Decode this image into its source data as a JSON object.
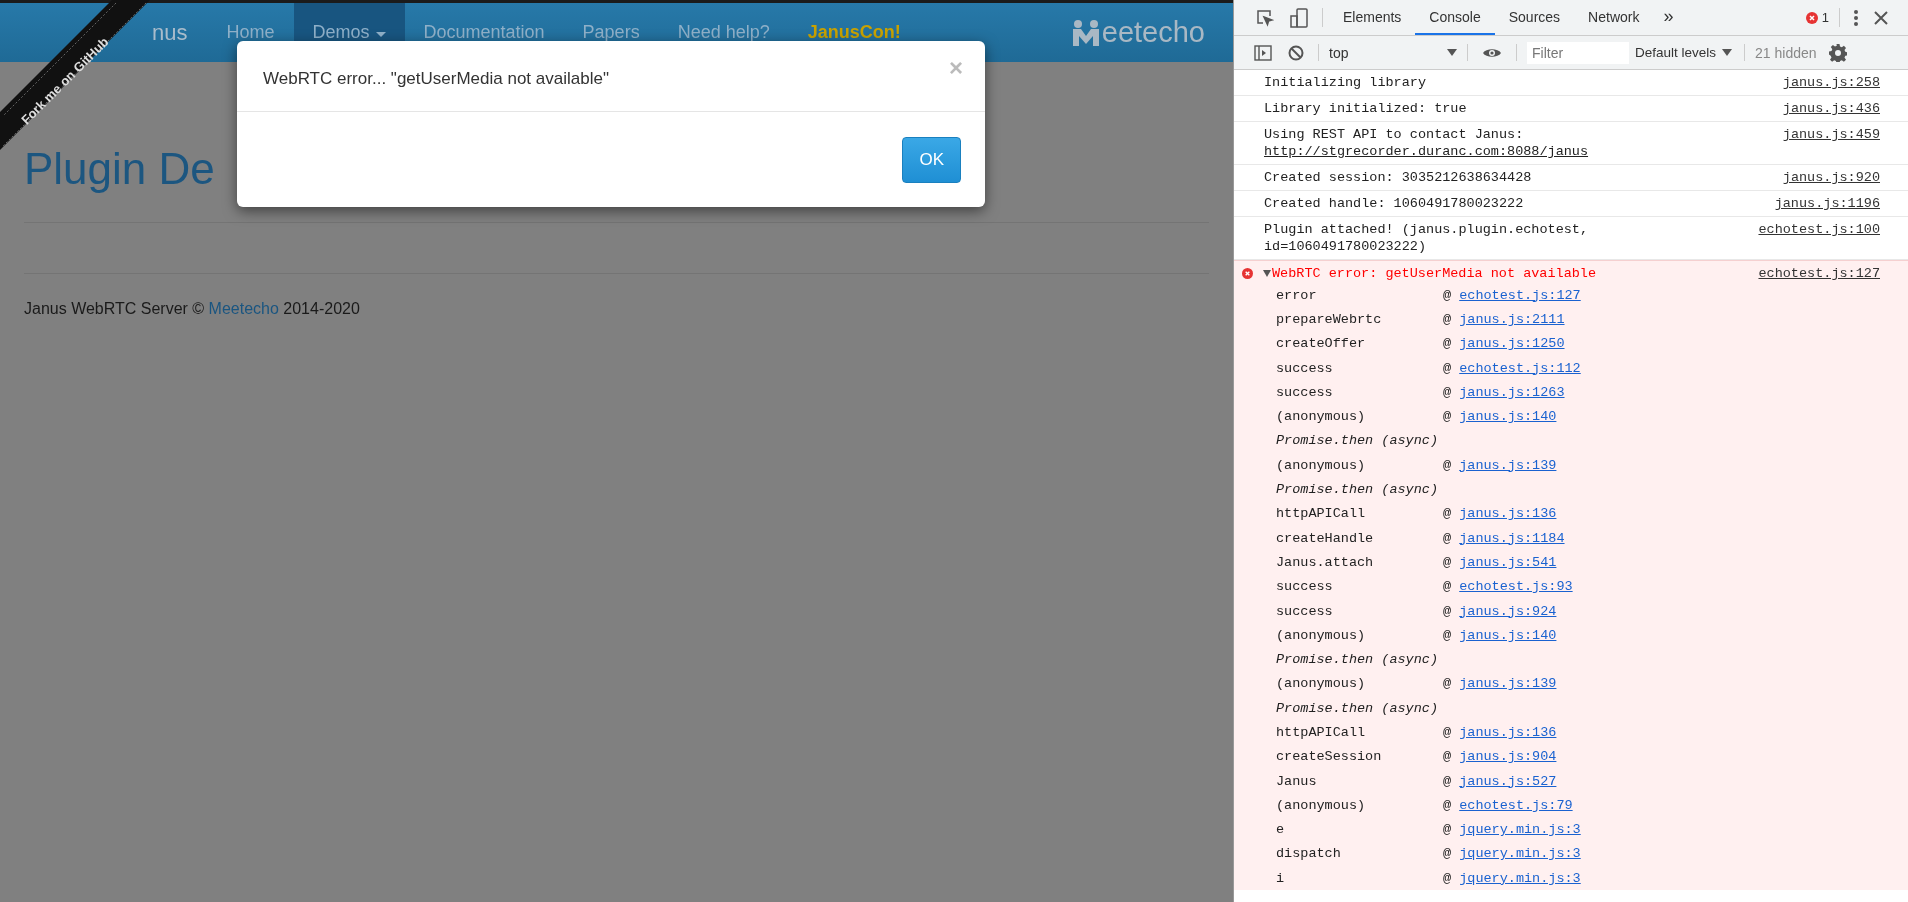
{
  "ribbon": {
    "text": "Fork me on GitHub"
  },
  "navbar": {
    "brand": "nus",
    "items": [
      {
        "label": "Home",
        "selected": false,
        "kind": "link"
      },
      {
        "label": "Demos",
        "selected": true,
        "kind": "dropdown"
      },
      {
        "label": "Documentation",
        "selected": false,
        "kind": "link"
      },
      {
        "label": "Papers",
        "selected": false,
        "kind": "link"
      },
      {
        "label": "Need help?",
        "selected": false,
        "kind": "link"
      },
      {
        "label": "JanusCon!",
        "selected": false,
        "kind": "highlight"
      }
    ],
    "logo": "eetecho"
  },
  "page": {
    "heading": "Plugin De",
    "footer": {
      "before": "Janus WebRTC Server © ",
      "link": "Meetecho",
      "after": " 2014-2020"
    }
  },
  "modal": {
    "message": "WebRTC error... \"getUserMedia not available\"",
    "close": "×",
    "button": "OK"
  },
  "devtools": {
    "tabs": [
      {
        "label": "Elements",
        "selected": false
      },
      {
        "label": "Console",
        "selected": true
      },
      {
        "label": "Sources",
        "selected": false
      },
      {
        "label": "Network",
        "selected": false
      }
    ],
    "more": "»",
    "error_count": "1",
    "context": "top",
    "filter_placeholder": "Filter",
    "levels": "Default levels",
    "hidden": "21 hidden",
    "messages": [
      {
        "kind": "log",
        "text": "Initializing library",
        "source": "janus.js:258"
      },
      {
        "kind": "log",
        "text": "Library initialized: true",
        "source": "janus.js:436"
      },
      {
        "kind": "log",
        "text": "Using REST API to contact Janus: ",
        "url": "http://stgrecorder.duranc.com:8088/janus",
        "source": "janus.js:459"
      },
      {
        "kind": "log",
        "text": "Created session: 3035212638634428",
        "source": "janus.js:920"
      },
      {
        "kind": "log",
        "text": "Created handle: 1060491780023222",
        "source": "janus.js:1196"
      },
      {
        "kind": "log",
        "text": "Plugin attached! (janus.plugin.echotest, id=1060491780023222)",
        "source": "echotest.js:100"
      },
      {
        "kind": "error",
        "text": "WebRTC error: getUserMedia not available",
        "source": "echotest.js:127",
        "expanded": true,
        "stack": [
          {
            "kind": "frame",
            "fn": "error",
            "at": "@",
            "source": "echotest.js:127"
          },
          {
            "kind": "frame",
            "fn": "prepareWebrtc",
            "at": "@",
            "source": "janus.js:2111"
          },
          {
            "kind": "frame",
            "fn": "createOffer",
            "at": "@",
            "source": "janus.js:1250"
          },
          {
            "kind": "frame",
            "fn": "success",
            "at": "@",
            "source": "echotest.js:112"
          },
          {
            "kind": "frame",
            "fn": "success",
            "at": "@",
            "source": "janus.js:1263"
          },
          {
            "kind": "frame",
            "fn": "(anonymous)",
            "at": "@",
            "source": "janus.js:140"
          },
          {
            "kind": "async",
            "fn": "Promise.then (async)"
          },
          {
            "kind": "frame",
            "fn": "(anonymous)",
            "at": "@",
            "source": "janus.js:139"
          },
          {
            "kind": "async",
            "fn": "Promise.then (async)"
          },
          {
            "kind": "frame",
            "fn": "httpAPICall",
            "at": "@",
            "source": "janus.js:136"
          },
          {
            "kind": "frame",
            "fn": "createHandle",
            "at": "@",
            "source": "janus.js:1184"
          },
          {
            "kind": "frame",
            "fn": "Janus.attach",
            "at": "@",
            "source": "janus.js:541"
          },
          {
            "kind": "frame",
            "fn": "success",
            "at": "@",
            "source": "echotest.js:93"
          },
          {
            "kind": "frame",
            "fn": "success",
            "at": "@",
            "source": "janus.js:924"
          },
          {
            "kind": "frame",
            "fn": "(anonymous)",
            "at": "@",
            "source": "janus.js:140"
          },
          {
            "kind": "async",
            "fn": "Promise.then (async)"
          },
          {
            "kind": "frame",
            "fn": "(anonymous)",
            "at": "@",
            "source": "janus.js:139"
          },
          {
            "kind": "async",
            "fn": "Promise.then (async)"
          },
          {
            "kind": "frame",
            "fn": "httpAPICall",
            "at": "@",
            "source": "janus.js:136"
          },
          {
            "kind": "frame",
            "fn": "createSession",
            "at": "@",
            "source": "janus.js:904"
          },
          {
            "kind": "frame",
            "fn": "Janus",
            "at": "@",
            "source": "janus.js:527"
          },
          {
            "kind": "frame",
            "fn": "(anonymous)",
            "at": "@",
            "source": "echotest.js:79"
          },
          {
            "kind": "frame",
            "fn": "e",
            "at": "@",
            "source": "jquery.min.js:3"
          },
          {
            "kind": "frame",
            "fn": "dispatch",
            "at": "@",
            "source": "jquery.min.js:3"
          },
          {
            "kind": "frame",
            "fn": "i",
            "at": "@",
            "source": "jquery.min.js:3"
          }
        ]
      }
    ]
  }
}
